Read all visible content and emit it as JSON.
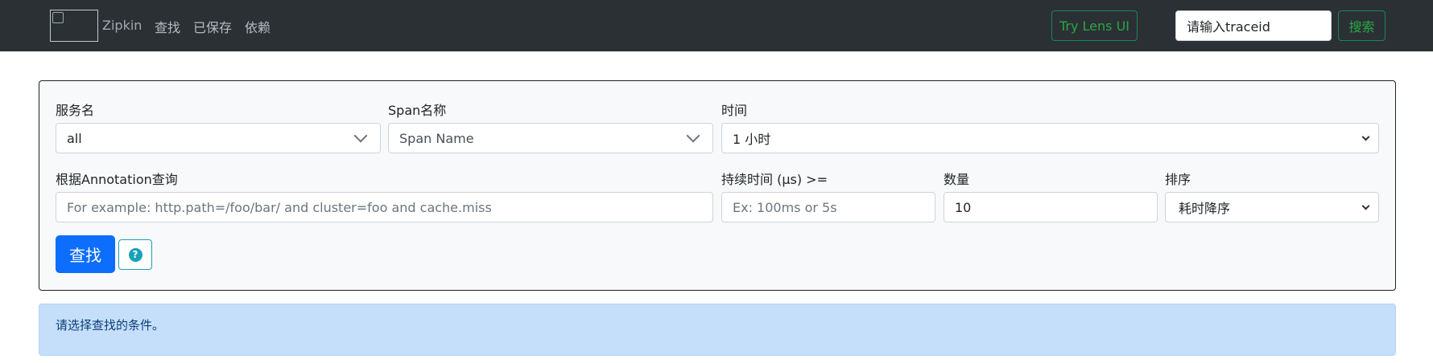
{
  "nav": {
    "brand": "Zipkin",
    "links": [
      "查找",
      "已保存",
      "依赖"
    ],
    "try_lens": "Try Lens UI",
    "traceid_placeholder": "请输入traceid",
    "search_button": "搜索"
  },
  "form": {
    "service_label": "服务名",
    "service_value": "all",
    "span_label": "Span名称",
    "span_value": "Span Name",
    "time_label": "时间",
    "time_value": "1 小时",
    "annotation_label": "根据Annotation查询",
    "annotation_placeholder": "For example: http.path=/foo/bar/ and cluster=foo and cache.miss",
    "duration_label": "持续时间 (μs) >=",
    "duration_placeholder": "Ex: 100ms or 5s",
    "limit_label": "数量",
    "limit_value": "10",
    "sort_label": "排序",
    "sort_value": "耗时降序",
    "find_button": "查找",
    "help_icon": "question-circle-icon"
  },
  "alert": {
    "text": "请选择查找的条件。"
  },
  "colors": {
    "navbar_bg": "#2b3035",
    "success": "#28a745",
    "primary": "#0d6efd",
    "info": "#17a2b8",
    "alert_bg": "#c5dffb"
  }
}
